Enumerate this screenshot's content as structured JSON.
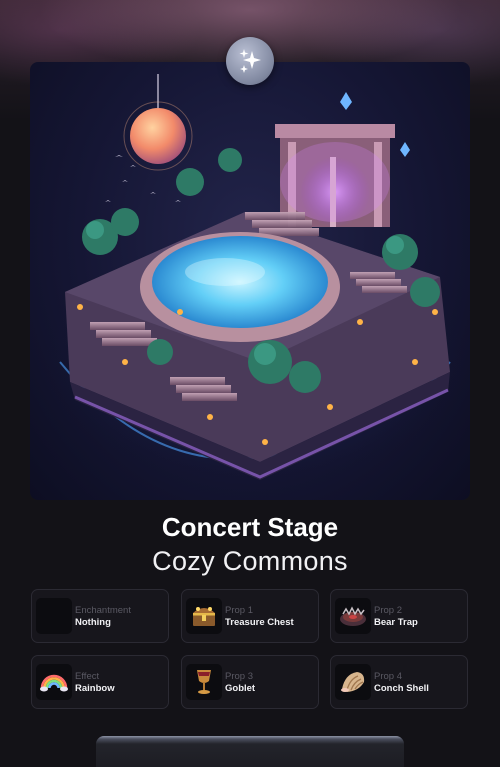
{
  "item": {
    "title": "Concert Stage",
    "subtitle": "Cozy Commons",
    "badge_icon": "sparkles-icon",
    "image_subject": "floating island concert stage"
  },
  "traits": [
    {
      "category": "Enchantment",
      "value": "Nothing",
      "icon": "empty-slot-icon"
    },
    {
      "category": "Prop 1",
      "value": "Treasure Chest",
      "icon": "treasure-chest-icon"
    },
    {
      "category": "Prop 2",
      "value": "Bear Trap",
      "icon": "bear-trap-icon"
    },
    {
      "category": "Effect",
      "value": "Rainbow",
      "icon": "rainbow-icon"
    },
    {
      "category": "Prop 3",
      "value": "Goblet",
      "icon": "goblet-icon"
    },
    {
      "category": "Prop 4",
      "value": "Conch Shell",
      "icon": "conch-shell-icon"
    }
  ],
  "colors": {
    "background": "#131217",
    "card_background": "#17161c",
    "card_border": "#2b2a33",
    "label_muted": "#5a5963",
    "text_primary": "#ffffff",
    "water": "#6fd6ff",
    "glow": "#c77dff"
  }
}
